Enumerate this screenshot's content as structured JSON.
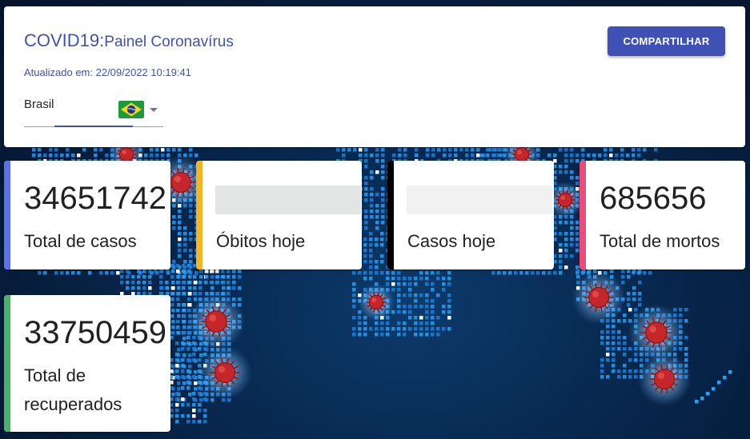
{
  "header": {
    "title_main": "COVID19:",
    "title_sub": "Painel Coronavírus",
    "updated": "Atualizado em: 22/09/2022 10:19:41",
    "share_label": "COMPARTILHAR",
    "accent_color": "#3f51b5"
  },
  "country_select": {
    "value": "Brasil",
    "flag_icon": "brazil-flag-icon"
  },
  "cards": {
    "total_cases": {
      "value": "34651742",
      "label": "Total de casos",
      "color": "#5b6fef"
    },
    "deaths_today": {
      "value": "",
      "label": "Óbitos hoje",
      "color": "#f4b524"
    },
    "cases_today": {
      "value": "",
      "label": "Casos hoje",
      "color": "#000000"
    },
    "total_deaths": {
      "value": "685656",
      "label": "Total de mortos",
      "color": "#ea4d79"
    },
    "total_recovered": {
      "value": "33750459",
      "label": "Total de recuperados",
      "color": "#4caf6a"
    }
  }
}
